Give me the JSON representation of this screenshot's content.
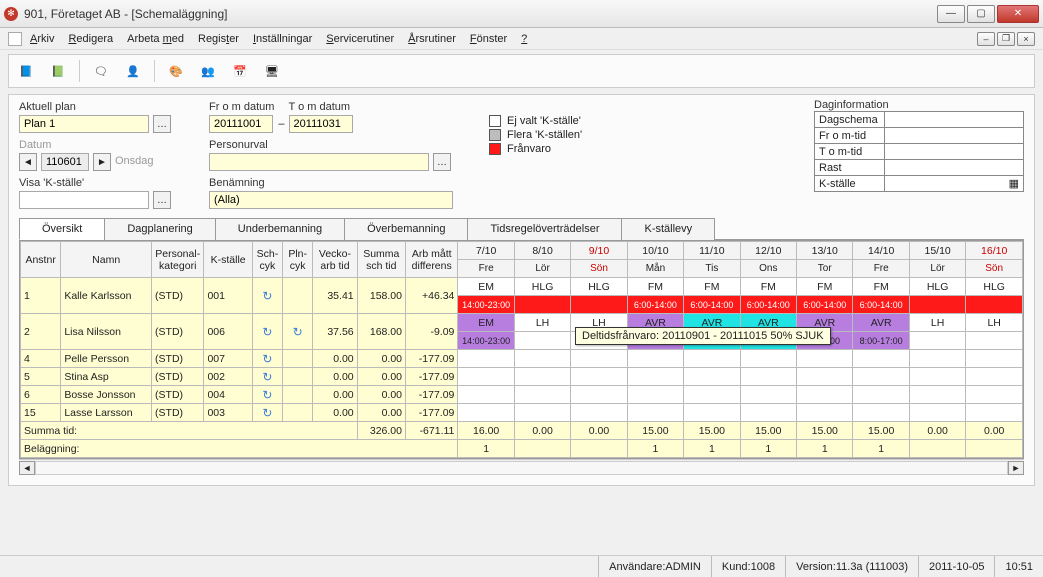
{
  "window": {
    "title": "901, Företaget AB - [Schemaläggning]"
  },
  "menu": {
    "items": [
      "Arkiv",
      "Redigera",
      "Arbeta med",
      "Register",
      "Inställningar",
      "Servicerutiner",
      "Årsrutiner",
      "Fönster",
      "?"
    ]
  },
  "form": {
    "aktuell_plan_label": "Aktuell plan",
    "aktuell_plan": "Plan 1",
    "from_label": "Fr o m datum",
    "tom_label": "T o m datum",
    "from_date": "20111001",
    "dash": "–",
    "tom_date": "20111031",
    "datum_label": "Datum",
    "datum": "110601",
    "weekday": "Onsdag",
    "personurval_label": "Personurval",
    "personurval": "",
    "visa_label": "Visa 'K-ställe'",
    "visa": "",
    "benamning_label": "Benämning",
    "benamning": "(Alla)"
  },
  "legend": {
    "l1": "Ej valt 'K-ställe'",
    "l2": "Flera 'K-ställen'",
    "l3": "Frånvaro",
    "c1": "#ffffff",
    "c2": "#bdbdbd",
    "c3": "#ff1a1a"
  },
  "dag": {
    "title": "Daginformation",
    "r1": "Dagschema",
    "r2": "Fr o m-tid",
    "r3": "T o m-tid",
    "r4": "Rast",
    "r5": "K-ställe"
  },
  "tabs": [
    "Översikt",
    "Dagplanering",
    "Underbemanning",
    "Överbemanning",
    "Tidsregelöverträdelser",
    "K-ställevy"
  ],
  "grid": {
    "head1": [
      "Anstnr",
      "Namn",
      "Personal-\nkategori",
      "K-ställe",
      "Sch-\ncyk",
      "Pln-\ncyk",
      "Vecko-\narb tid",
      "Summa\nsch tid",
      "Arb mått\ndifferens"
    ],
    "days": [
      {
        "d": "7/10",
        "w": "Fre"
      },
      {
        "d": "8/10",
        "w": "Lör"
      },
      {
        "d": "9/10",
        "w": "Sön",
        "red": true
      },
      {
        "d": "10/10",
        "w": "Mån"
      },
      {
        "d": "11/10",
        "w": "Tis"
      },
      {
        "d": "12/10",
        "w": "Ons"
      },
      {
        "d": "13/10",
        "w": "Tor"
      },
      {
        "d": "14/10",
        "w": "Fre"
      },
      {
        "d": "15/10",
        "w": "Lör"
      },
      {
        "d": "16/10",
        "w": "Sön",
        "red": true
      }
    ],
    "rows": [
      {
        "nr": "1",
        "namn": "Kalle Karlsson",
        "kat": "(STD)",
        "ks": "001",
        "v": "35.41",
        "s": "158.00",
        "d": "+46.34",
        "cells": [
          {
            "t": "EM"
          },
          {
            "t": "HLG"
          },
          {
            "t": "HLG"
          },
          {
            "t": "FM"
          },
          {
            "t": "FM"
          },
          {
            "t": "FM"
          },
          {
            "t": "FM"
          },
          {
            "t": "FM"
          },
          {
            "t": "HLG"
          },
          {
            "t": "HLG"
          }
        ],
        "sub": [
          {
            "t": "14:00-23:00",
            "cls": "cell-red"
          },
          {
            "t": "",
            "cls": "cell-red"
          },
          {
            "t": "",
            "cls": "cell-red"
          },
          {
            "t": "6:00-14:00",
            "cls": "cell-red"
          },
          {
            "t": "6:00-14:00",
            "cls": "cell-red"
          },
          {
            "t": "6:00-14:00",
            "cls": "cell-red"
          },
          {
            "t": "6:00-14:00",
            "cls": "cell-red"
          },
          {
            "t": "6:00-14:00",
            "cls": "cell-red"
          },
          {
            "t": "",
            "cls": "cell-red"
          },
          {
            "t": "",
            "cls": "cell-red"
          }
        ]
      },
      {
        "nr": "2",
        "namn": "Lisa Nilsson",
        "kat": "(STD)",
        "ks": "006",
        "v": "37.56",
        "s": "168.00",
        "d": "-9.09",
        "pln": true,
        "cells": [
          {
            "t": "EM",
            "cls": "cell-purple"
          },
          {
            "t": "LH"
          },
          {
            "t": "LH"
          },
          {
            "t": "AVR",
            "cls": "cell-purple"
          },
          {
            "t": "AVR",
            "cls": "cell-cyan"
          },
          {
            "t": "AVR",
            "cls": "cell-cyan"
          },
          {
            "t": "AVR",
            "cls": "cell-purple"
          },
          {
            "t": "AVR",
            "cls": "cell-purple"
          },
          {
            "t": "LH"
          },
          {
            "t": "LH"
          }
        ],
        "sub": [
          {
            "t": "14:00-23:00",
            "cls": "cell-purple"
          },
          {
            "t": ""
          },
          {
            "t": ""
          },
          {
            "t": "",
            "cls": "cell-purple"
          },
          {
            "t": "",
            "cls": "cell-cyan"
          },
          {
            "t": "",
            "cls": "cell-cyan"
          },
          {
            "t": "0-17:00",
            "cls": "cell-purple"
          },
          {
            "t": "8:00-17:00",
            "cls": "cell-purple"
          },
          {
            "t": ""
          },
          {
            "t": ""
          }
        ]
      },
      {
        "nr": "4",
        "namn": "Pelle Persson",
        "kat": "(STD)",
        "ks": "007",
        "v": "0.00",
        "s": "0.00",
        "d": "-177.09"
      },
      {
        "nr": "5",
        "namn": "Stina Asp",
        "kat": "(STD)",
        "ks": "002",
        "v": "0.00",
        "s": "0.00",
        "d": "-177.09"
      },
      {
        "nr": "6",
        "namn": "Bosse Jonsson",
        "kat": "(STD)",
        "ks": "004",
        "v": "0.00",
        "s": "0.00",
        "d": "-177.09"
      },
      {
        "nr": "15",
        "namn": "Lasse Larsson",
        "kat": "(STD)",
        "ks": "003",
        "v": "0.00",
        "s": "0.00",
        "d": "-177.09"
      }
    ],
    "summa_label": "Summa tid:",
    "summa": {
      "s": "326.00",
      "d": "-671.11",
      "days": [
        "16.00",
        "0.00",
        "0.00",
        "15.00",
        "15.00",
        "15.00",
        "15.00",
        "15.00",
        "0.00",
        "0.00"
      ]
    },
    "belagg_label": "Beläggning:",
    "belagg": [
      "1",
      "",
      "",
      "1",
      "1",
      "1",
      "1",
      "1",
      "",
      ""
    ]
  },
  "tooltip": "Deltidsfrånvaro: 20110901 - 20111015 50% SJUK",
  "status": {
    "user_label": "Användare: ",
    "user": "ADMIN",
    "kund_label": "Kund: ",
    "kund": "1008",
    "ver_label": "Version: ",
    "ver": "11.3a (111003)",
    "date": "2011-10-05",
    "time": "10:51"
  }
}
